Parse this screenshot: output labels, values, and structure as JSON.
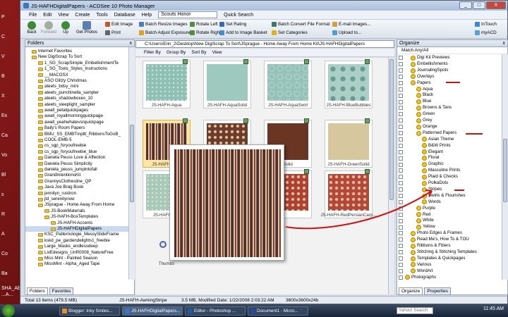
{
  "desktop": {
    "left_labels": [
      "P",
      "C",
      "V",
      "B",
      "X",
      "Ex",
      "Ca",
      "Vo",
      "Bl",
      "s",
      "R",
      "A",
      "Co",
      "Ba"
    ],
    "bottom_labels": [
      "SHA_Abt8",
      "...A..."
    ]
  },
  "window": {
    "title": "JS-HAFHDigitalPapers - ACDSee 10 Photo Manager",
    "btn_min": "_",
    "btn_max": "□",
    "btn_close": "X"
  },
  "menu": {
    "items": [
      "File",
      "Edit",
      "View",
      "Create",
      "Tools",
      "Database",
      "Help"
    ],
    "combo_value": "Scouts Honor",
    "quick_search": "Quick Search"
  },
  "toolbar": {
    "back": "Back",
    "forward": "Forward",
    "up": "Up",
    "get_photos": "Get Photos",
    "edit_image": "Edit Image",
    "print": "Print",
    "batch_resize": "Batch Resize Images",
    "batch_exposure": "Batch Adjust Exposure",
    "rotate_left": "Rotate Left",
    "rotate_right": "Rotate Right",
    "set_rating": "Set Rating",
    "add_basket": "Add to Image Basket",
    "batch_convert": "Batch Convert File Format",
    "set_categories": "Set Categories",
    "email_images": "E-mail Images...",
    "upload": "Upload to...",
    "intouch": "InTouch",
    "myacd": "myACD"
  },
  "folders": {
    "title": "Folders",
    "close": "x",
    "tabs": [
      "Folders",
      "Favorites"
    ],
    "items": [
      {
        "label": "Internet Favorites",
        "indent": 1
      },
      {
        "label": "New DigiScrap To Sort",
        "indent": 1
      },
      {
        "label": "1_SG_ScrapSimple_EmbellishmentTe",
        "indent": 2
      },
      {
        "label": "1_SG_Tools_Styles_Instructions",
        "indent": 2
      },
      {
        "label": "__MACOSX",
        "indent": 2
      },
      {
        "label": "ASO Glitzy Christmas",
        "indent": 2
      },
      {
        "label": "ateets_bdsy_mini",
        "indent": 2
      },
      {
        "label": "ateets_punchinella_sampler",
        "indent": 2
      },
      {
        "label": "ateets_shadowboxes_10",
        "indent": 2
      },
      {
        "label": "ateets_sleeplight_sampler",
        "indent": 2
      },
      {
        "label": "awall_petalquickpages",
        "indent": 2
      },
      {
        "label": "awall_royallmorningquickpage",
        "indent": 2
      },
      {
        "label": "awall_yeahwhatevsrquickpage",
        "indent": 2
      },
      {
        "label": "Baily's Room Papers",
        "indent": 2
      },
      {
        "label": "BMU_SS_EMBTmpltt_RibbonsToGoB_",
        "indent": 2
      },
      {
        "label": "COOL-EMB-5",
        "indent": 2
      },
      {
        "label": "cs_sgp_foryoufreebie",
        "indent": 2
      },
      {
        "label": "cs_sgp_foryoufreebie_blue",
        "indent": 2
      },
      {
        "label": "Daniela Peuss Love & Affection",
        "indent": 2
      },
      {
        "label": "Daniela Peuss Simplicity",
        "indent": 2
      },
      {
        "label": "daniela_peuss_jumpintofall",
        "indent": 2
      },
      {
        "label": "GrandIntentionsKit",
        "indent": 2
      },
      {
        "label": "GrannysClothesline_QP",
        "indent": 2
      },
      {
        "label": "Java Joe Brag Book",
        "indent": 2
      },
      {
        "label": "jennilyn_rustiron",
        "indent": 2
      },
      {
        "label": "jld_serenitynow",
        "indent": 2
      },
      {
        "label": "JSprague - Home Away From Home",
        "indent": 2
      },
      {
        "label": "JS-BookMaterials",
        "indent": 3
      },
      {
        "label": "JS-HAFH-BoxTemplates",
        "indent": 3
      },
      {
        "label": "JS-HAFH-Accents",
        "indent": 4
      },
      {
        "label": "JS-HAFHDigitalPapers",
        "indent": 4
      },
      {
        "label": "KSC_Patternologie_MessySlideFrame",
        "indent": 2
      },
      {
        "label": "kskd_pe_gardendelights1_freebie",
        "indent": 2
      },
      {
        "label": "Large_Masks_endlessdeep",
        "indent": 2
      },
      {
        "label": "LivEdesigns_UnR0008_NatureFree",
        "indent": 2
      },
      {
        "label": "Miss Mint - Painted Season",
        "indent": 2
      },
      {
        "label": "MissMint - Alpha_Aged Tape",
        "indent": 2
      }
    ],
    "selected": "JS-HAFHDigitalPapers"
  },
  "browser": {
    "path": "C:\\Users\\Erin_2\\Desktop\\New DigiScrap To Sort\\JSprague - Home Away From Home Kit\\JS-HAFHDigitalPapers",
    "filter": "Filter By",
    "group": "Group By",
    "sort": "Sort By",
    "view": "View",
    "thumbs": [
      {
        "label": "JS-HAFH-Aqua",
        "color": "#8fc0b4",
        "pattern": "dots"
      },
      {
        "label": "JS-HAFH-AquaSolid",
        "color": "#9ec9bf",
        "pattern": "solid"
      },
      {
        "label": "JS-HAFH-AquaSwirl",
        "color": "#94c2b8",
        "pattern": "swirl"
      },
      {
        "label": "JS-HAFH-BlueBubbles",
        "color": "#a9cfc6",
        "pattern": "bubbles"
      },
      {
        "label": "JS-HAFH-Awni",
        "color": "#7a3a32",
        "pattern": "stripes"
      },
      {
        "label": "",
        "color": "#6b3b2c",
        "pattern": "floral"
      },
      {
        "label": "Solid",
        "color": "#6a3522",
        "pattern": "solid"
      },
      {
        "label": "JS-HAFH-GreenSolid",
        "color": "#d6c79f",
        "pattern": "solid"
      },
      {
        "label": "JS-HAFH-Gre",
        "color": "#a8c9b6",
        "pattern": "dots"
      },
      {
        "label": "",
        "color": "#b64a3c",
        "pattern": "floral"
      },
      {
        "label": "",
        "color": "#ae3f33",
        "pattern": "floral"
      },
      {
        "label": "JS-HAFH-RedPersianCarp...",
        "color": "#b4473c",
        "pattern": "floral"
      },
      {
        "label": "Thumbs",
        "color": "#f2f2f2",
        "pattern": "none"
      }
    ]
  },
  "organize": {
    "title": "Organize",
    "close": "x",
    "match": "Match Any/All",
    "tabs": [
      "Organize",
      "Properties"
    ],
    "items": [
      {
        "label": "Digi Kit Previews",
        "indent": 1
      },
      {
        "label": "Embellishments",
        "indent": 1
      },
      {
        "label": "JournalingSpots",
        "indent": 1
      },
      {
        "label": "Overlays",
        "indent": 1
      },
      {
        "label": "Papers",
        "indent": 1
      },
      {
        "label": "Aqua",
        "indent": 2
      },
      {
        "label": "Black",
        "indent": 2
      },
      {
        "label": "Blue",
        "indent": 2
      },
      {
        "label": "Browns & Tans",
        "indent": 2
      },
      {
        "label": "Green",
        "indent": 2
      },
      {
        "label": "Grey",
        "indent": 2
      },
      {
        "label": "Orange",
        "indent": 2
      },
      {
        "label": "Patterned Papers",
        "indent": 2
      },
      {
        "label": "Asian Theme",
        "indent": 3
      },
      {
        "label": "B&W Prints",
        "indent": 3
      },
      {
        "label": "Elegant",
        "indent": 3
      },
      {
        "label": "Floral",
        "indent": 3
      },
      {
        "label": "Graphic",
        "indent": 3
      },
      {
        "label": "Masculine Prints",
        "indent": 3
      },
      {
        "label": "Plaid & Checks",
        "indent": 3
      },
      {
        "label": "PolkaDots",
        "indent": 3
      },
      {
        "label": "Stripes",
        "indent": 3
      },
      {
        "label": "Swirls & Flourishes",
        "indent": 3
      },
      {
        "label": "Words",
        "indent": 3
      },
      {
        "label": "Purple",
        "indent": 2
      },
      {
        "label": "Red",
        "indent": 2
      },
      {
        "label": "White",
        "indent": 2
      },
      {
        "label": "Yellow",
        "indent": 2
      },
      {
        "label": "Photo Edges & Frames",
        "indent": 1
      },
      {
        "label": "Read Me's, How To & TOU",
        "indent": 1
      },
      {
        "label": "Ribbons & Fibers",
        "indent": 1
      },
      {
        "label": "Stitching & Stitching Templates",
        "indent": 1
      },
      {
        "label": "Templates & Quickpages",
        "indent": 1
      },
      {
        "label": "Various",
        "indent": 1
      },
      {
        "label": "WordArt",
        "indent": 1
      },
      {
        "label": "Photographs",
        "indent": 0
      }
    ]
  },
  "status": {
    "total": "Total 13 items (479.5 MB)",
    "file": "JS-HAFH-AwningStripe",
    "size": "3.5 MB, Modified Date: 1/22/2008 2:03:22 AM",
    "dims": "3600x3600x24b"
  },
  "taskbar": {
    "tasks": [
      "Blogger: Inky Smiles...",
      "JS-HAFHDigitalPapers...",
      "Editor - Photoshop ...",
      "Document1 - Micro..."
    ],
    "search_placeholder": "Yahoo! Search",
    "clock": "11:45 AM"
  },
  "colors": {
    "annotation_red": "#d11010",
    "stripes_dark": "#5a2a24",
    "stripes_light": "#d9c6a6"
  }
}
